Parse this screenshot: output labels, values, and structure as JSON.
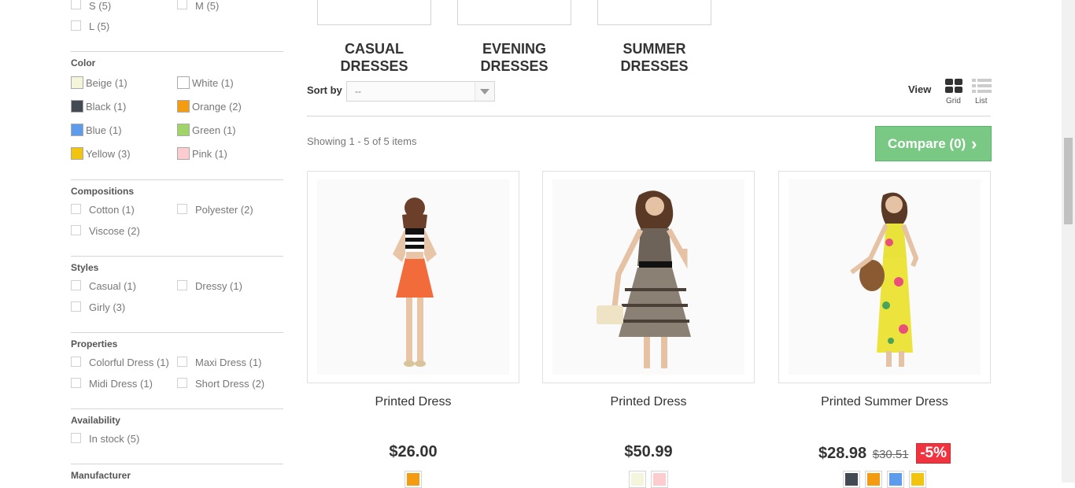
{
  "filters": {
    "size": {
      "items": [
        {
          "label": "S (5)"
        },
        {
          "label": "M (5)"
        },
        {
          "label": "L (5)"
        }
      ]
    },
    "color": {
      "title": "Color",
      "items": [
        {
          "label": "Beige (1)",
          "swatch": "#f5f5dc"
        },
        {
          "label": "White (1)",
          "swatch": "#ffffff"
        },
        {
          "label": "Black (1)",
          "swatch": "#434a54"
        },
        {
          "label": "Orange (2)",
          "swatch": "#f39c11"
        },
        {
          "label": "Blue (1)",
          "swatch": "#5d9cec"
        },
        {
          "label": "Green (1)",
          "swatch": "#a0d468"
        },
        {
          "label": "Yellow (3)",
          "swatch": "#f1c40f"
        },
        {
          "label": "Pink (1)",
          "swatch": "#fcccce"
        }
      ]
    },
    "compositions": {
      "title": "Compositions",
      "items": [
        {
          "label": "Cotton (1)"
        },
        {
          "label": "Polyester (2)"
        },
        {
          "label": "Viscose (2)"
        }
      ]
    },
    "styles": {
      "title": "Styles",
      "items": [
        {
          "label": "Casual (1)"
        },
        {
          "label": "Dressy (1)"
        },
        {
          "label": "Girly (3)"
        }
      ]
    },
    "properties": {
      "title": "Properties",
      "items": [
        {
          "label": "Colorful Dress (1)"
        },
        {
          "label": "Maxi Dress (1)"
        },
        {
          "label": "Midi Dress (1)"
        },
        {
          "label": "Short Dress (2)"
        }
      ]
    },
    "availability": {
      "title": "Availability",
      "items": [
        {
          "label": "In stock (5)"
        }
      ]
    },
    "manufacturer": {
      "title": "Manufacturer"
    }
  },
  "subcategories": [
    {
      "line1": "CASUAL",
      "line2": "DRESSES"
    },
    {
      "line1": "EVENING",
      "line2": "DRESSES"
    },
    {
      "line1": "SUMMER",
      "line2": "DRESSES"
    }
  ],
  "toolbar": {
    "sort_label": "Sort by",
    "sort_value": "--",
    "view_label": "View",
    "grid_label": "Grid",
    "list_label": "List",
    "showing": "Showing 1 - 5 of 5 items",
    "compare_label": "Compare (0)"
  },
  "products": [
    {
      "name": "Printed Dress",
      "price": "$26.00",
      "old_price": "",
      "discount": "",
      "colors": [
        "#f39c11"
      ]
    },
    {
      "name": "Printed Dress",
      "price": "$50.99",
      "old_price": "",
      "discount": "",
      "colors": [
        "#f5f5dc",
        "#fcccce"
      ]
    },
    {
      "name": "Printed Summer Dress",
      "price": "$28.98",
      "old_price": "$30.51",
      "discount": "-5%",
      "colors": [
        "#434a54",
        "#f39c11",
        "#5d9cec",
        "#f1c40f"
      ]
    }
  ]
}
